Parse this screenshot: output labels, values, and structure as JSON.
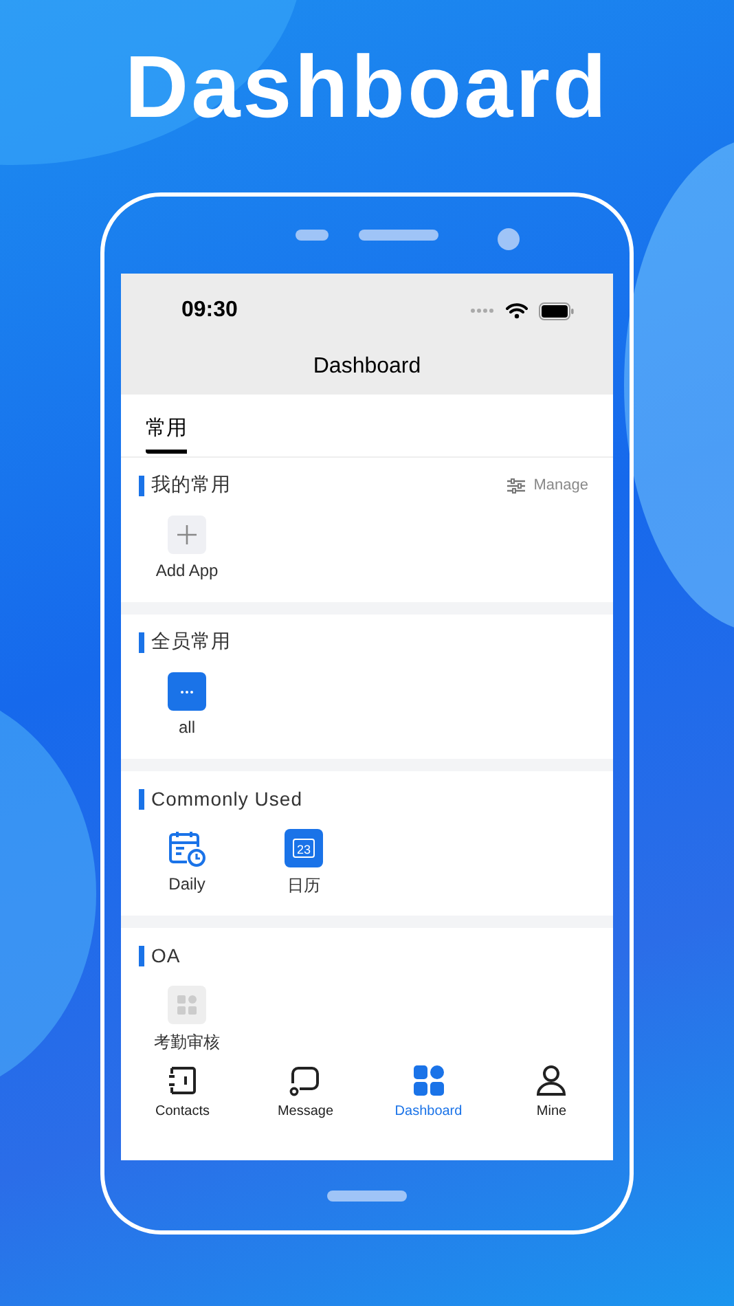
{
  "headline": "Dashboard",
  "status_bar": {
    "time": "09:30"
  },
  "nav": {
    "title": "Dashboard"
  },
  "tabs": [
    {
      "label": "常用",
      "selected": true
    }
  ],
  "sections": [
    {
      "title": "我的常用",
      "action": "Manage",
      "apps": [
        {
          "kind": "add",
          "label": "Add App"
        }
      ]
    },
    {
      "title": "全员常用",
      "apps": [
        {
          "kind": "more",
          "label": "all"
        }
      ]
    },
    {
      "title": "Commonly Used",
      "apps": [
        {
          "kind": "daily",
          "label": "Daily"
        },
        {
          "kind": "calendar",
          "label": "日历",
          "icon_text": "23"
        }
      ]
    },
    {
      "title": "OA",
      "apps": [
        {
          "kind": "grid",
          "label": "考勤审核"
        }
      ]
    }
  ],
  "tab_bar": [
    {
      "kind": "contacts",
      "label": "Contacts",
      "selected": false
    },
    {
      "kind": "message",
      "label": "Message",
      "selected": false
    },
    {
      "kind": "dashboard",
      "label": "Dashboard",
      "selected": true
    },
    {
      "kind": "mine",
      "label": "Mine",
      "selected": false
    }
  ]
}
